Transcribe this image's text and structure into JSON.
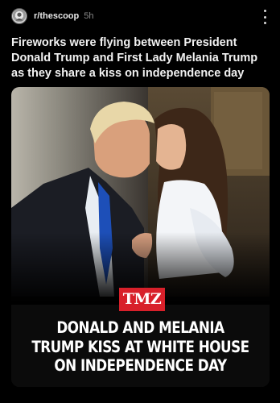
{
  "post": {
    "community": "r/thescoop",
    "age": "5h",
    "title": "Fireworks were flying between President Donald Trump and First Lady Melania Trump as they share a kiss on independence day"
  },
  "image": {
    "logo_text": "TMZ",
    "headline_lines": [
      "DONALD AND MELANIA",
      "TRUMP KISS AT WHITE HOUSE",
      "ON INDEPENDENCE DAY"
    ]
  },
  "colors": {
    "background": "#000000",
    "logo_red": "#d8202a",
    "meta_gray": "#8a8a8a"
  },
  "icons": {
    "avatar": "community-avatar-icon",
    "menu": "more-vertical-icon"
  }
}
